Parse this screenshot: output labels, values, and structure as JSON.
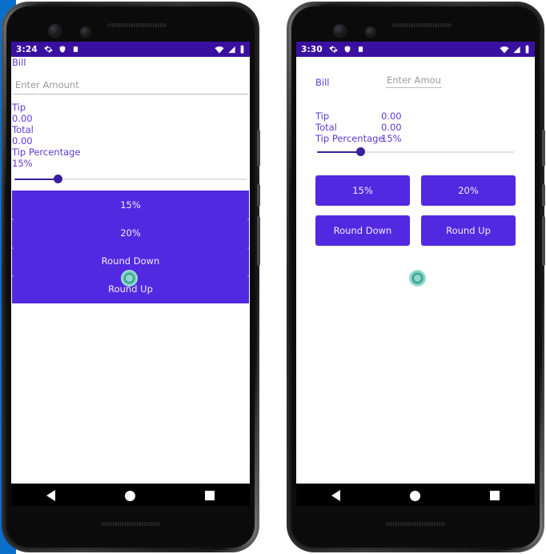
{
  "colors": {
    "backdrop_blue": "#0b6ecb",
    "status_bar_purple": "#3a10a0",
    "button_purple": "#5229e0",
    "text_purple": "#5b3ad6",
    "slider_active": "#3a1f9e",
    "slider_track": "#e3e3e3",
    "touch_indicator_teal": "#6fc9bb"
  },
  "phones": [
    {
      "id": "left",
      "variant": "unconstrained-layout",
      "status_bar": {
        "time": "3:24",
        "left_icons": [
          "gear-icon",
          "shield-icon",
          "clipboard-icon"
        ],
        "right_icons": [
          "wifi-icon",
          "cellular-signal-icon",
          "battery-icon"
        ]
      },
      "app": {
        "bill_label": "Bill",
        "amount_input": {
          "value": "",
          "placeholder": "Enter Amount"
        },
        "rows": [
          {
            "label": "Tip",
            "value": "0.00"
          },
          {
            "label": "Total",
            "value": "0.00"
          },
          {
            "label": "Tip Percentage",
            "value": "15%"
          }
        ],
        "slider": {
          "value": 15,
          "min": 0,
          "max": 100,
          "fill_percent": 20
        },
        "buttons": [
          "15%",
          "20%",
          "Round Down",
          "Round Up"
        ]
      },
      "nav_bar": {
        "back": "back-icon",
        "home": "home-icon",
        "recents": "recents-icon"
      },
      "touch_indicator": {
        "visible": true,
        "over_label": "Round Up"
      }
    },
    {
      "id": "right",
      "variant": "constrained-layout",
      "status_bar": {
        "time": "3:30",
        "left_icons": [
          "gear-icon",
          "shield-icon",
          "clipboard-icon"
        ],
        "right_icons": [
          "wifi-icon",
          "cellular-signal-icon",
          "battery-icon"
        ]
      },
      "app": {
        "bill_label": "Bill",
        "amount_input": {
          "value": "",
          "placeholder": "Enter Amount"
        },
        "rows": [
          {
            "label": "Tip",
            "value": "0.00"
          },
          {
            "label": "Total",
            "value": "0.00"
          },
          {
            "label": "Tip Percentage",
            "value": "15%"
          }
        ],
        "slider": {
          "value": 15,
          "min": 0,
          "max": 100,
          "fill_percent": 23
        },
        "buttons": [
          "15%",
          "20%",
          "Round Down",
          "Round Up"
        ]
      },
      "nav_bar": {
        "back": "back-icon",
        "home": "home-icon",
        "recents": "recents-icon"
      },
      "touch_indicator": {
        "visible": true,
        "over_label": ""
      }
    }
  ]
}
